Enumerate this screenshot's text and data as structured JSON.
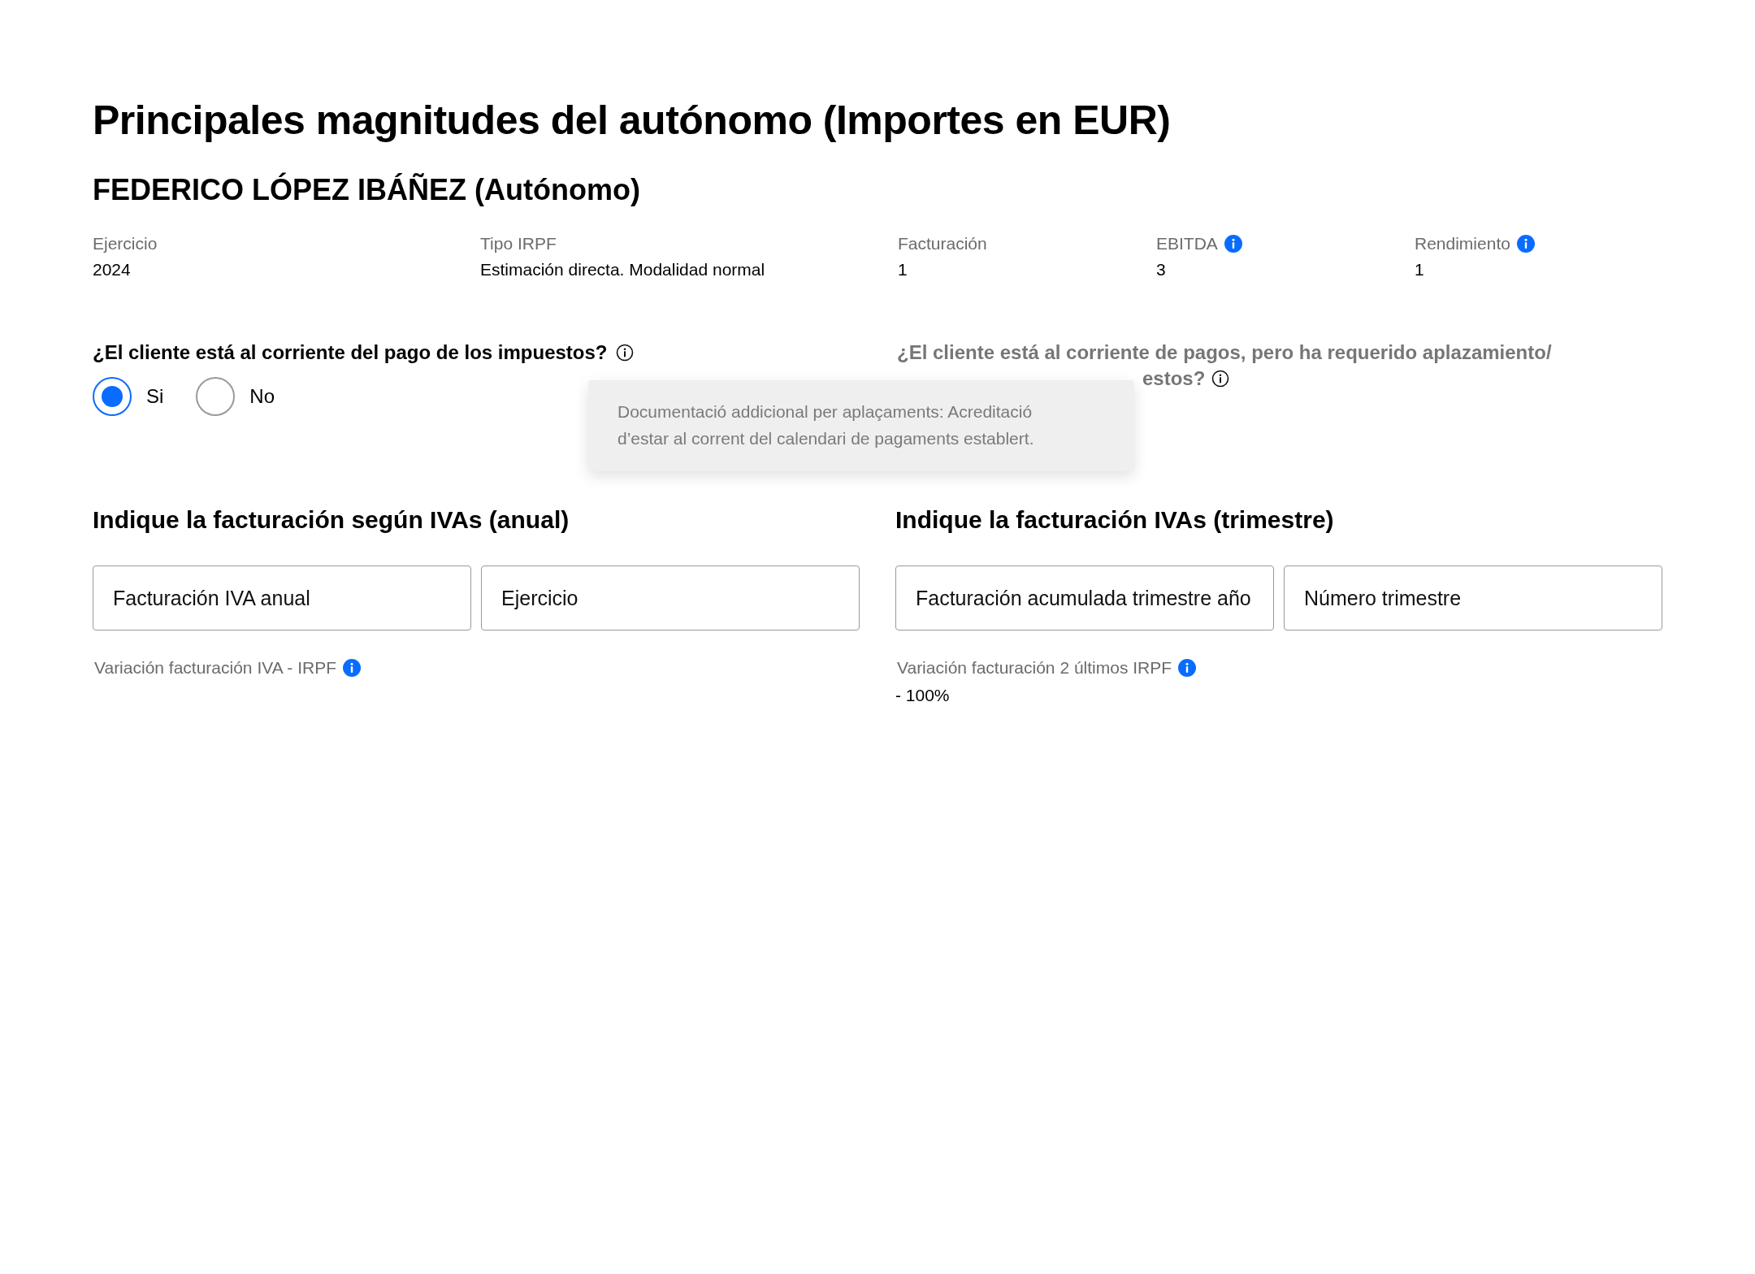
{
  "page_title": "Principales magnitudes del autónomo (Importes en EUR)",
  "client_name": "FEDERICO LÓPEZ IBÁÑEZ (Autónomo)",
  "summary": [
    {
      "label": "Ejercicio",
      "value": "2024",
      "info": false
    },
    {
      "label": "Tipo IRPF",
      "value": "Estimación directa. Modalidad normal",
      "info": false
    },
    {
      "label": "Facturación",
      "value": "1",
      "info": false
    },
    {
      "label": "EBITDA",
      "value": "3",
      "info": true
    },
    {
      "label": "Rendimiento",
      "value": "1",
      "info": true
    }
  ],
  "tax_question": {
    "text": "¿El cliente está al corriente del pago de los impuestos?",
    "options": [
      {
        "label": "Si",
        "selected": true
      },
      {
        "label": "No",
        "selected": false
      }
    ]
  },
  "deferral_question": {
    "line_1": "¿El cliente está al corriente de pagos, pero ha requerido aplazamiento/",
    "line_2_visible": "estos?"
  },
  "tooltip": {
    "lines": [
      "Documentació addicional per aplaçaments: Acreditació",
      "d’estar al corrent del calendari de pagaments establert."
    ]
  },
  "sections": [
    {
      "heading": "Indique la facturación según IVAs (anual)",
      "fields": [
        {
          "placeholder": "Facturación IVA anual"
        },
        {
          "placeholder": "Ejercicio"
        }
      ],
      "metric": {
        "label": "Variación facturación IVA - IRPF"
      }
    },
    {
      "heading": "Indique la facturación  IVAs (trimestre)",
      "fields": [
        {
          "placeholder": "Facturación acumulada trimestre año"
        },
        {
          "placeholder": "Número trimestre"
        }
      ],
      "metric": {
        "label": "Variación facturación 2 últimos IRPF",
        "value": "- 100%"
      }
    }
  ]
}
